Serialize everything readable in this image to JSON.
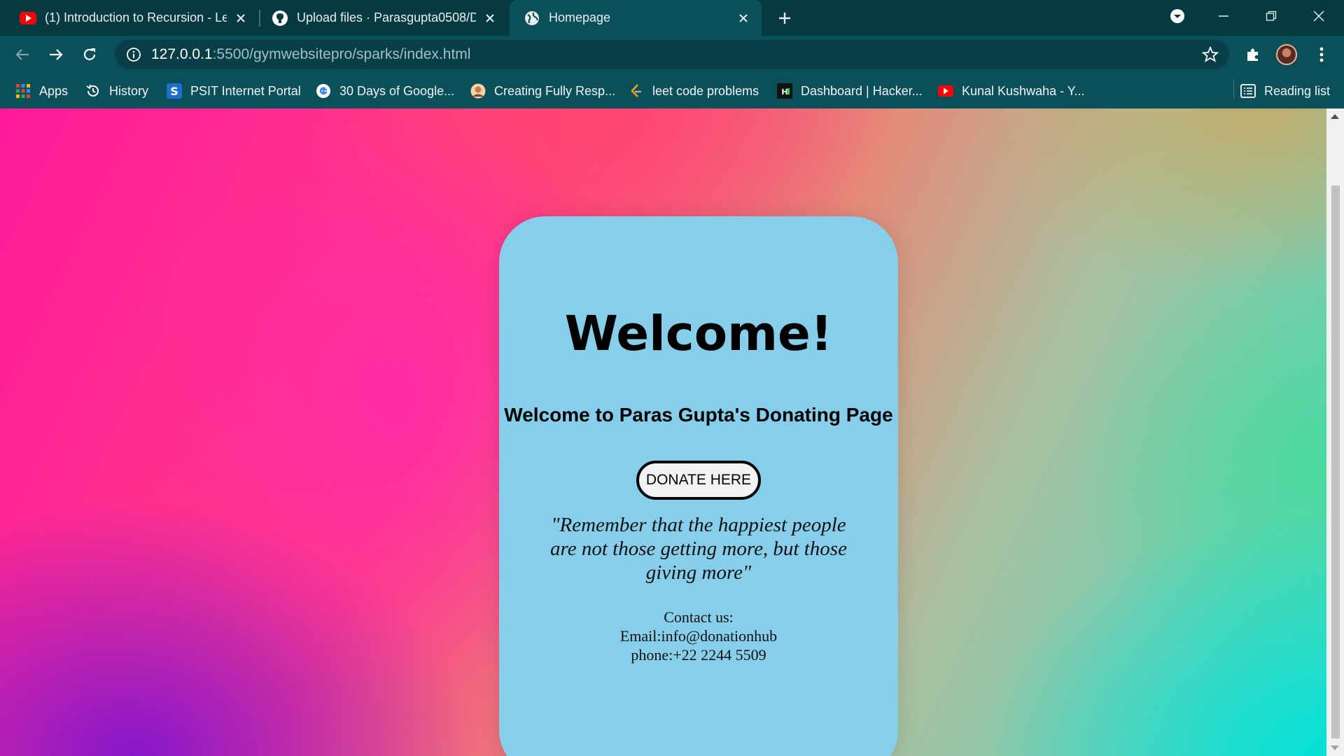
{
  "browser": {
    "tabs": [
      {
        "title": "(1) Introduction to Recursion - Le",
        "icon": "youtube-icon",
        "active": false
      },
      {
        "title": "Upload files · Parasgupta0508/D",
        "icon": "github-icon",
        "active": false
      },
      {
        "title": "Homepage",
        "icon": "globe-icon",
        "active": true
      }
    ],
    "address": {
      "host": "127.0.0.1",
      "rest": ":5500/gymwebsitepro/sparks/index.html"
    },
    "bookmarks": [
      {
        "label": "Apps",
        "icon": "apps-grid-icon"
      },
      {
        "label": "History",
        "icon": "history-icon"
      },
      {
        "label": "PSIT Internet Portal",
        "icon": "psit-s-icon"
      },
      {
        "label": "30 Days of Google...",
        "icon": "google-icon"
      },
      {
        "label": "Creating Fully Resp...",
        "icon": "profile-photo-icon"
      },
      {
        "label": "leet code problems",
        "icon": "leetcode-icon"
      },
      {
        "label": "Dashboard | Hacker...",
        "icon": "hackerrank-icon"
      },
      {
        "label": "Kunal Kushwaha - Y...",
        "icon": "youtube-icon"
      }
    ],
    "reading_list": "Reading list",
    "colors": {
      "frame": "#063a42",
      "toolbar": "#0b4f59",
      "card": "#87ceeb"
    }
  },
  "page": {
    "heading": "Welcome!",
    "subheading": "Welcome to Paras Gupta's Donating Page",
    "donate_label": "DONATE HERE",
    "quote": "\"Remember that the happiest people are not those getting more, but those giving more\"",
    "contact": {
      "label": "Contact us:",
      "email": "Email:info@donationhub",
      "phone": "phone:+22 2244 5509"
    }
  }
}
